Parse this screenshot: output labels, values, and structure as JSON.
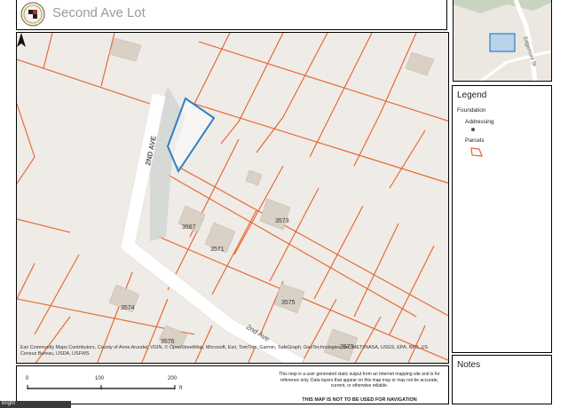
{
  "header": {
    "title": "Second Ave Lot"
  },
  "map": {
    "street_labels": [
      "2ND AVE",
      "2nd Ave"
    ],
    "address_labels": [
      "3567",
      "3571",
      "3573",
      "3574",
      "3575",
      "3576",
      "3579"
    ],
    "attribution": "Esri Community Maps Contributors, County of Anne Arundel, VGIN, © OpenStreetMap, Microsoft, Esri, TomTom, Garmin, SafeGraph, GeoTechnologies, Inc, METI/NASA, USGS, EPA, NPS, US Census Bureau, USDA, USFWS",
    "colors": {
      "background": "#efebe6",
      "parcel_line": "#e4632a",
      "road": "#ffffff",
      "building": "#d9d0c6",
      "selected_parcel": "#2f7fc4",
      "water": "#cfd4d2"
    }
  },
  "inset": {
    "street_label": "Edgemont St"
  },
  "legend": {
    "title": "Legend",
    "group": "Foundation",
    "item_addressing": "Addressing",
    "item_parcels": "Parcels"
  },
  "notes": {
    "title": "Notes"
  },
  "scale": {
    "labels": [
      "0",
      "100",
      "200"
    ],
    "unit": "ft"
  },
  "disclaimer": "This map is a user generated static output from an Internet mapping site and is for reference only. Data layers that appear on this map may or may not be accurate, current, or otherwise reliable.",
  "nav_warning": "THIS MAP IS NOT TO BE USED FOR NAVIGATION",
  "bottom_bar_text": "bright"
}
